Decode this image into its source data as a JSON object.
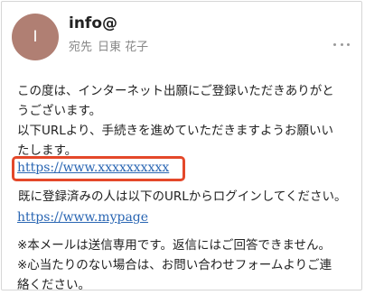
{
  "email": {
    "sender": {
      "avatar_initial": "I",
      "name": "info@",
      "to_label": "宛先",
      "recipient_name": "日東 花子"
    },
    "body": {
      "para1_line1": "この度は、インターネット出願にご登録いただきありがと",
      "para1_line2": "うございます。",
      "para2_line1": "以下URLより、手続きを進めていただきますようお願いい",
      "para2_line2": "たします。",
      "link1": "https://www.xxxxxxxxxx",
      "para3": "既に登録済みの人は以下のURLからログインしてください。",
      "link2": "https://www.mypage",
      "note1": "※本メールは送信専用です。返信にはご回答できません。",
      "note2_line1": "※心当たりのない場合は、お問い合わせフォームよりご連",
      "note2_line2": "絡ください。"
    }
  },
  "icons": {
    "more": "more-horizontal-icon"
  },
  "colors": {
    "avatar_bg": "#b07f73",
    "link": "#2a66b3",
    "highlight_box": "#e4482a"
  }
}
